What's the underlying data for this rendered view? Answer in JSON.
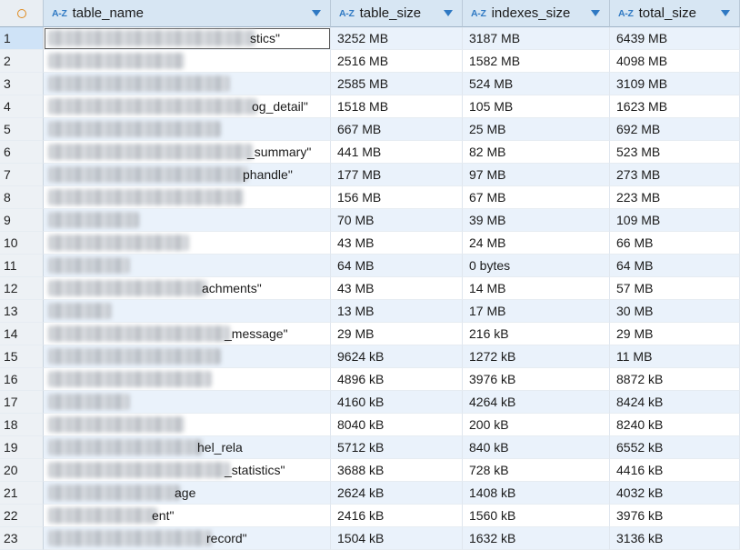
{
  "header": {
    "columns": [
      {
        "label": "table_name"
      },
      {
        "label": "table_size"
      },
      {
        "label": "indexes_size"
      },
      {
        "label": "total_size"
      }
    ],
    "type_badge": "A-Z"
  },
  "rows": [
    {
      "num": "1",
      "name": "stics\"",
      "table_size": "3252 MB",
      "indexes_size": "3187 MB",
      "total_size": "6439 MB"
    },
    {
      "num": "2",
      "name": "",
      "table_size": "2516 MB",
      "indexes_size": "1582 MB",
      "total_size": "4098 MB"
    },
    {
      "num": "3",
      "name": "",
      "table_size": "2585 MB",
      "indexes_size": "524 MB",
      "total_size": "3109 MB"
    },
    {
      "num": "4",
      "name": "og_detail\"",
      "table_size": "1518 MB",
      "indexes_size": "105 MB",
      "total_size": "1623 MB"
    },
    {
      "num": "5",
      "name": "",
      "table_size": "667 MB",
      "indexes_size": "25 MB",
      "total_size": "692 MB"
    },
    {
      "num": "6",
      "name": "_summary\"",
      "table_size": "441 MB",
      "indexes_size": "82 MB",
      "total_size": "523 MB"
    },
    {
      "num": "7",
      "name": "phandle\"",
      "table_size": "177 MB",
      "indexes_size": "97 MB",
      "total_size": "273 MB"
    },
    {
      "num": "8",
      "name": "",
      "table_size": "156 MB",
      "indexes_size": "67 MB",
      "total_size": "223 MB"
    },
    {
      "num": "9",
      "name": "",
      "table_size": "70 MB",
      "indexes_size": "39 MB",
      "total_size": "109 MB"
    },
    {
      "num": "10",
      "name": "",
      "table_size": "43 MB",
      "indexes_size": "24 MB",
      "total_size": "66 MB"
    },
    {
      "num": "11",
      "name": "",
      "table_size": "64 MB",
      "indexes_size": "0 bytes",
      "total_size": "64 MB"
    },
    {
      "num": "12",
      "name": "achments\"",
      "table_size": "43 MB",
      "indexes_size": "14 MB",
      "total_size": "57 MB"
    },
    {
      "num": "13",
      "name": "",
      "table_size": "13 MB",
      "indexes_size": "17 MB",
      "total_size": "30 MB"
    },
    {
      "num": "14",
      "name": "_message\"",
      "table_size": "29 MB",
      "indexes_size": "216 kB",
      "total_size": "29 MB"
    },
    {
      "num": "15",
      "name": "",
      "table_size": "9624 kB",
      "indexes_size": "1272 kB",
      "total_size": "11 MB"
    },
    {
      "num": "16",
      "name": "",
      "table_size": "4896 kB",
      "indexes_size": "3976 kB",
      "total_size": "8872 kB"
    },
    {
      "num": "17",
      "name": "",
      "table_size": "4160 kB",
      "indexes_size": "4264 kB",
      "total_size": "8424 kB"
    },
    {
      "num": "18",
      "name": "",
      "table_size": "8040 kB",
      "indexes_size": "200 kB",
      "total_size": "8240 kB"
    },
    {
      "num": "19",
      "name": "hel_rela",
      "table_size": "5712 kB",
      "indexes_size": "840 kB",
      "total_size": "6552 kB"
    },
    {
      "num": "20",
      "name": "_statistics\"",
      "table_size": "3688 kB",
      "indexes_size": "728 kB",
      "total_size": "4416 kB"
    },
    {
      "num": "21",
      "name": "age",
      "table_size": "2624 kB",
      "indexes_size": "1408 kB",
      "total_size": "4032 kB"
    },
    {
      "num": "22",
      "name": "ent\"",
      "table_size": "2416 kB",
      "indexes_size": "1560 kB",
      "total_size": "3976 kB"
    },
    {
      "num": "23",
      "name": "record\"",
      "table_size": "1504 kB",
      "indexes_size": "1632 kB",
      "total_size": "3136 kB"
    }
  ],
  "colors": {
    "header_bg": "#d7e6f3",
    "row_alt_bg": "#eaf2fb",
    "accent": "#2f79c3",
    "corner_ring": "#e08a1e"
  },
  "icons": {
    "corner": "circle-icon",
    "column_type": "az-text-type-icon",
    "sort": "sort-triangle-icon"
  }
}
